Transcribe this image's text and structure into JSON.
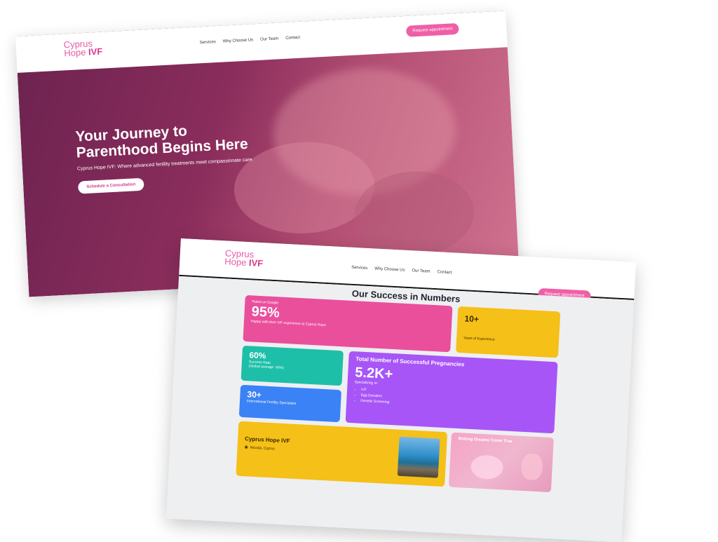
{
  "brand": {
    "line1": "Cyprus",
    "line2a": "Hope",
    "line2b": "IVF"
  },
  "nav": {
    "items": [
      "Services",
      "Why Choose Us",
      "Our Team",
      "Contact"
    ],
    "cta": "Request appointment"
  },
  "hero": {
    "title_line1": "Your Journey to",
    "title_line2": "Parenthood Begins Here",
    "subtitle": "Cyprus Hope IVF: Where advanced fertility treatments meet compassionate care.",
    "button": "Schedule a Consultation"
  },
  "stats": {
    "title": "Our Success in Numbers",
    "google": {
      "label": "Rated on Google",
      "value": "95%",
      "desc": "Happy with their IVF experience at Cyprus Hope"
    },
    "years": {
      "value": "10+",
      "label": "Years of Experience"
    },
    "success": {
      "value": "60%",
      "label": "Success Rate",
      "note": "(Global average: 40%)"
    },
    "specialists": {
      "value": "30+",
      "label": "International Fertility Specialists"
    },
    "pregnancies": {
      "title": "Total Number of Successful Pregnancies",
      "value": "5.2K+",
      "sub": "Specializing in:",
      "items": [
        "IVF",
        "Egg Donation",
        "Genetic Screening"
      ]
    },
    "location": {
      "name": "Cyprus Hope IVF",
      "place": "Nicosia, Cyprus"
    },
    "dreams": {
      "title": "Making Dreams Come True"
    }
  },
  "colors": {
    "brand_pink": "#ef5fa6",
    "hero_overlay": "#8a2d5c",
    "google_card": "#ea4f9c",
    "years_card": "#f5c017",
    "success_card": "#1ebfa8",
    "specialists_card": "#3b82f6",
    "pregnancies_card": "#a855f7"
  }
}
